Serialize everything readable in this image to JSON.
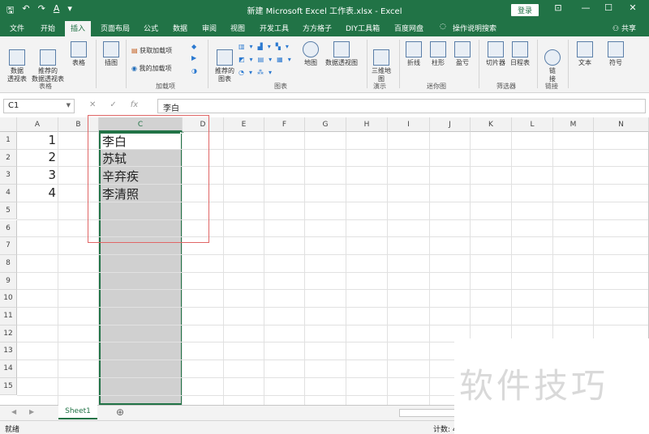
{
  "titlebar": {
    "qat": [
      "🖫",
      "↶",
      "↷",
      "A",
      "▾"
    ],
    "title": "新建 Microsoft Excel 工作表.xlsx  -  Excel",
    "login": "登录",
    "minimize": "—",
    "restore": "☐",
    "close": "✕",
    "ribbon_toggle": "⊡"
  },
  "tabs": [
    "文件",
    "开始",
    "插入",
    "页面布局",
    "公式",
    "数据",
    "审阅",
    "视图",
    "开发工具",
    "方方格子",
    "DIY工具箱",
    "百度网盘",
    "操作说明搜索"
  ],
  "active_tab": "插入",
  "share": "共享",
  "ribbon": {
    "pivot": "数据\n透视表",
    "rec_pivot": "推荐的\n数据透视表",
    "table": "表格",
    "group_tables": "表格",
    "illustrations": "插图",
    "get_addins": "获取加载项",
    "my_addins": "我的加载项",
    "group_addins": "加载项",
    "rec_charts": "推荐的\n图表",
    "map": "地图",
    "pivot_chart": "数据透视图",
    "group_charts": "图表",
    "map3d": "三维地\n图",
    "group_tours": "演示",
    "line": "折线",
    "column": "柱形",
    "winloss": "盈亏",
    "group_spark": "迷你图",
    "slicer": "切片器",
    "timeline": "日程表",
    "group_filters": "筛选器",
    "link": "链\n接",
    "group_links": "链接",
    "text": "文本",
    "symbol": "符号"
  },
  "formula": {
    "namebox": "C1",
    "cancel": "✕",
    "enter": "✓",
    "fx": "fx",
    "value": "李白"
  },
  "columns": [
    "A",
    "B",
    "C",
    "D",
    "E",
    "F",
    "G",
    "H",
    "I",
    "J",
    "K",
    "L",
    "M",
    "N"
  ],
  "rows": [
    "1",
    "2",
    "3",
    "4",
    "5",
    "6",
    "7",
    "8",
    "9",
    "10",
    "11",
    "12",
    "13",
    "14",
    "15"
  ],
  "cells": {
    "A1": "1",
    "A2": "2",
    "A3": "3",
    "A4": "4",
    "C1": "李白",
    "C2": "苏轼",
    "C3": "辛弃疾",
    "C4": "李清照"
  },
  "sheet": {
    "name": "Sheet1",
    "add": "⊕",
    "prev": "◀",
    "next": "▶"
  },
  "status": {
    "mode": "就绪",
    "count": "计数: 4"
  },
  "watermark": "软件技巧"
}
